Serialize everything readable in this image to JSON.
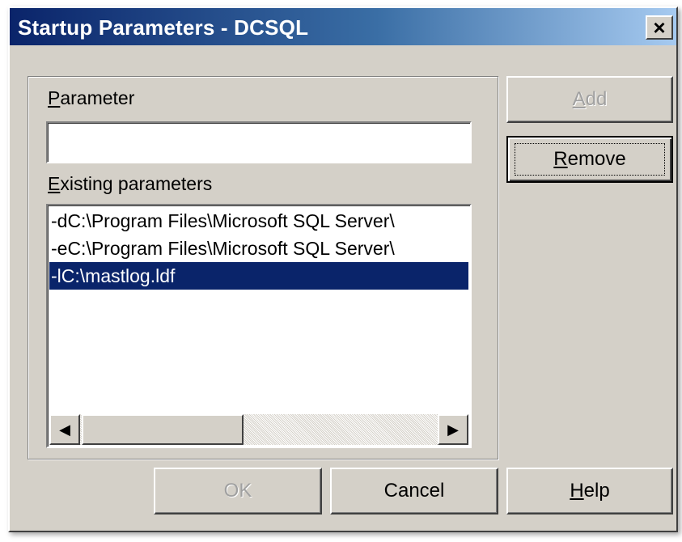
{
  "window": {
    "title": "Startup Parameters - DCSQL",
    "close_glyph": "×"
  },
  "form": {
    "parameter_label_accel": "P",
    "parameter_label_rest": "arameter",
    "parameter_value": "",
    "existing_label_accel": "E",
    "existing_label_rest": "xisting parameters"
  },
  "existing_parameters": [
    {
      "text": "-dC:\\Program Files\\Microsoft SQL Server\\",
      "selected": false
    },
    {
      "text": "-eC:\\Program Files\\Microsoft SQL Server\\",
      "selected": false
    },
    {
      "text": "-lC:\\mastlog.ldf",
      "selected": true
    }
  ],
  "scrollbar": {
    "left_arrow": "◀",
    "right_arrow": "▶"
  },
  "buttons": {
    "add_accel": "A",
    "add_rest": "dd",
    "add_enabled": false,
    "remove_accel": "R",
    "remove_rest": "emove",
    "ok": "OK",
    "ok_enabled": false,
    "cancel": "Cancel",
    "help_accel": "H",
    "help_rest": "elp"
  },
  "colors": {
    "dialog_face": "#d4d0c8",
    "title_gradient_start": "#0a246a",
    "title_gradient_end": "#a6caf0",
    "selection": "#0a246a"
  }
}
